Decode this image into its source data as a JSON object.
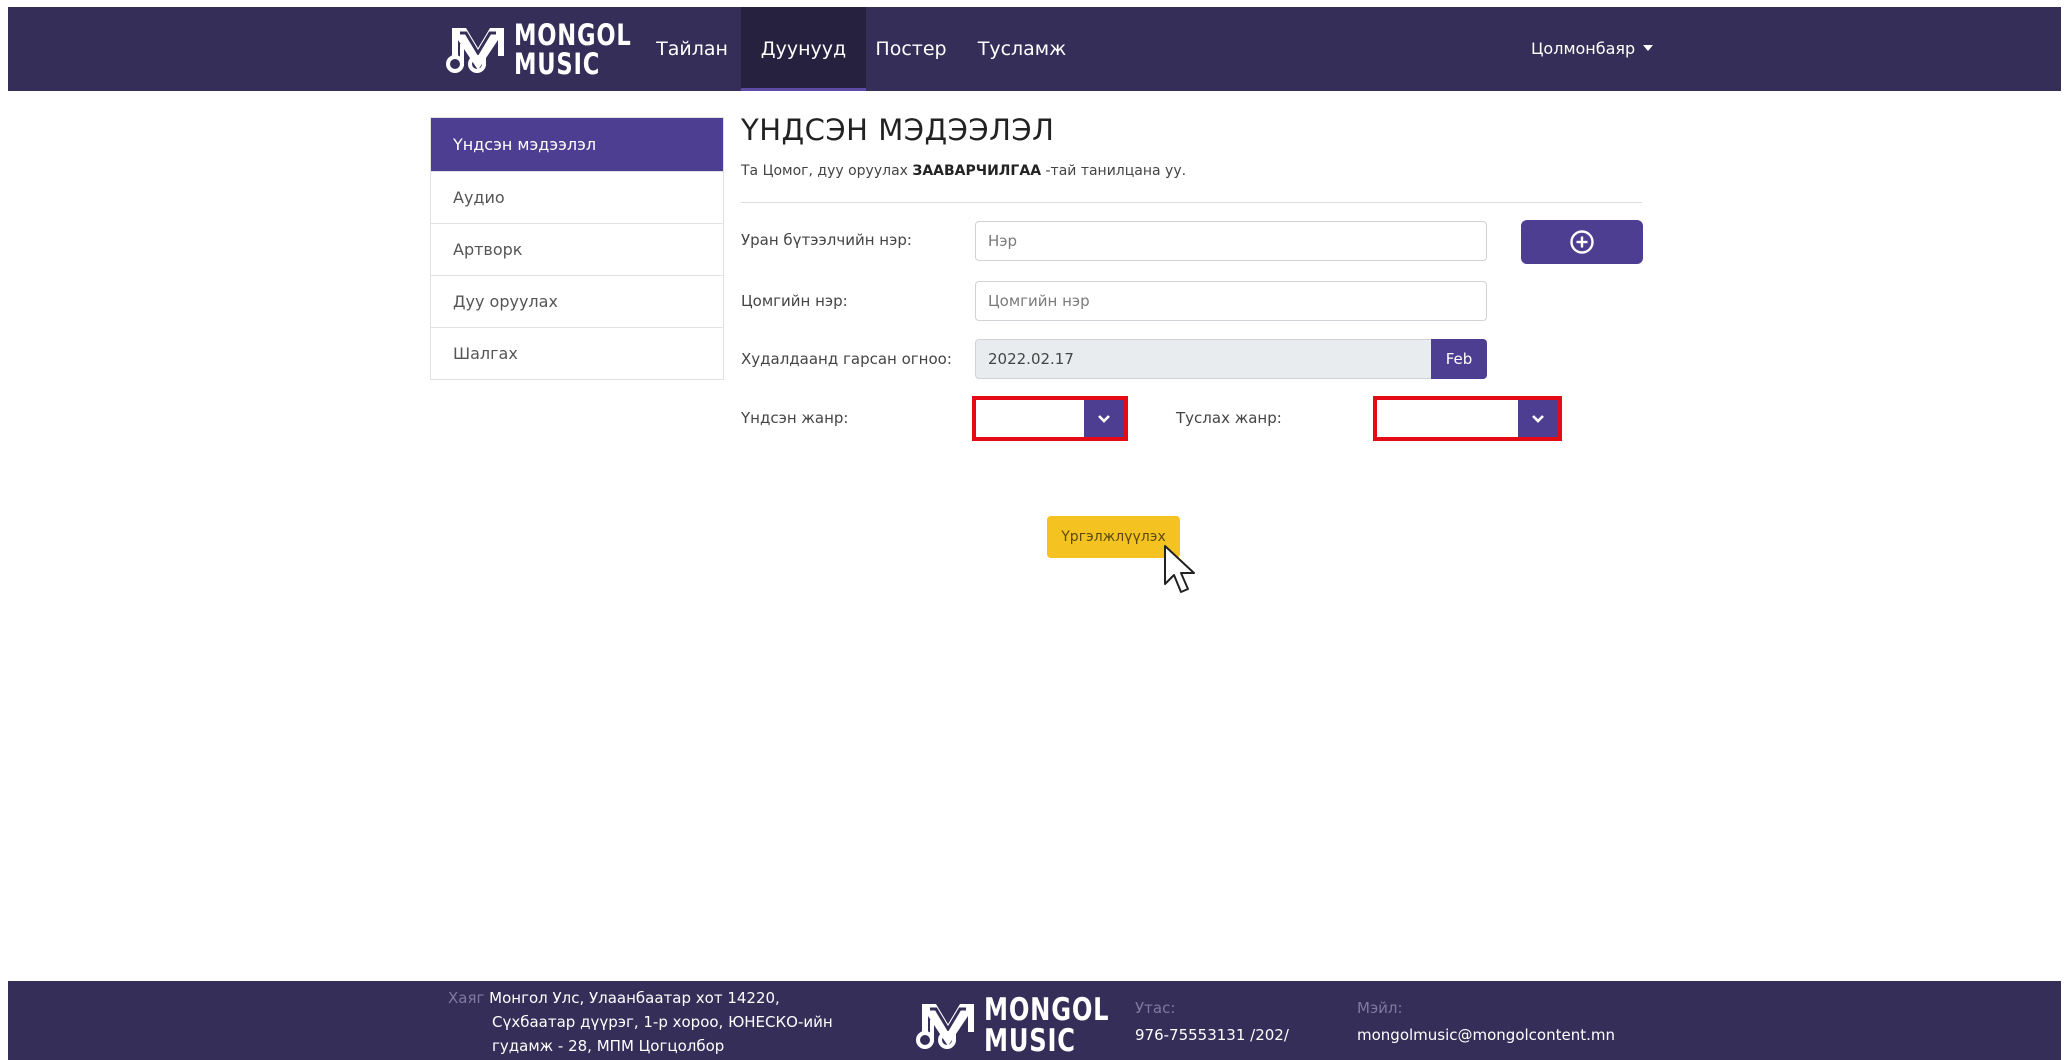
{
  "navbar": {
    "logo": {
      "line1": "MONGOL",
      "line2": "MUSIC"
    },
    "links": [
      {
        "label": "Тайлан"
      },
      {
        "label": "Дуунууд",
        "active": true
      },
      {
        "label": "Постер"
      },
      {
        "label": "Тусламж"
      }
    ],
    "user_name": "Цолмонбаяр"
  },
  "sidebar": {
    "items": [
      {
        "label": "Үндсэн мэдээлэл",
        "active": true
      },
      {
        "label": "Аудио"
      },
      {
        "label": "Артворк"
      },
      {
        "label": "Дуу оруулах"
      },
      {
        "label": "Шалгах"
      }
    ]
  },
  "main": {
    "title": "ҮНДСЭН МЭДЭЭЛЭЛ",
    "notice": {
      "prefix": "Та Цомог, дуу оруулах",
      "emphasis": "ЗААВАРЧИЛГАА",
      "suffix": "-тай танилцана уу."
    },
    "fields": {
      "artist_label": "Уран бүтээлчийн нэр:",
      "artist_placeholder": "Нэр",
      "album_label": "Цомгийн нэр:",
      "album_placeholder": "Цомгийн нэр",
      "release_date_label": "Худалдаанд гарсан огноо:",
      "release_date_value": "2022.02.17",
      "release_month_button": "Feb",
      "main_genre_label": "Үндсэн жанр:",
      "sub_genre_label": "Туслах жанр:"
    },
    "continue_label": "Үргэлжлүүлэх"
  },
  "footer": {
    "address_label": "Хаяг",
    "address_lines": [
      "Монгол Улс, Улаанбаатар хот 14220,",
      "Сүхбаатар дүүрэг, 1-р хороо, ЮНЕСКО-ийн",
      "гудамж - 28, МПМ Цогцолбор"
    ],
    "logo": {
      "line1": "MONGOL",
      "line2": "MUSIC"
    },
    "phone_label": "Утас:",
    "phone_value": "976-75553131 /202/",
    "email_label": "Мэйл:",
    "email_value": "mongolmusic@mongolcontent.mn"
  },
  "colors": {
    "navbar": "#342e58",
    "accent": "#4e3e91",
    "highlight": "#e40b17",
    "button": "#f5c321"
  },
  "icons": {
    "add": "plus-circle-icon",
    "dropdown": "chevron-down-icon",
    "cursor": "mouse-pointer-icon",
    "user_menu": "caret-down-icon"
  }
}
